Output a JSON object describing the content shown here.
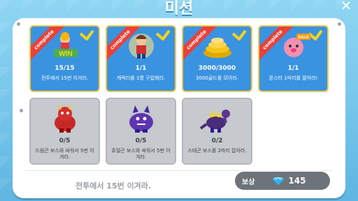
{
  "title": "미션",
  "close_icon": "close-icon",
  "missions": [
    {
      "status": "complete",
      "ribbon": "complete",
      "progress": "15/15",
      "description": "전투에서 15번 이겨라.",
      "icon": "win-trophy-icon"
    },
    {
      "status": "complete",
      "ribbon": "complete",
      "progress": "1/1",
      "description": "캐릭터를 1명 구입해라.",
      "icon": "character-icon"
    },
    {
      "status": "complete",
      "ribbon": "complete",
      "progress": "3000/3000",
      "description": "3000골드를 모아라.",
      "icon": "gold-coins-icon"
    },
    {
      "status": "complete",
      "ribbon": "complete",
      "progress": "1/1",
      "description": "몬스터 1마리를 팔아라!",
      "icon": "pig-monster-sale-icon",
      "badge": "SALE"
    },
    {
      "status": "incomplete",
      "progress": "0/5",
      "description": "드림곤 보스와 싸워서 5번 이겨라.",
      "icon": "red-dragon-boss-icon"
    },
    {
      "status": "incomplete",
      "progress": "0/5",
      "description": "쥬얼곤 보스와 싸워서 5번 이겨라.",
      "icon": "purple-dragon-boss-icon"
    },
    {
      "status": "incomplete",
      "progress": "0/2",
      "description": "스테곤 보스를 2마리 잡아라.",
      "icon": "stegosaurus-boss-icon"
    }
  ],
  "footer": {
    "current_mission": "전투에서 15번 이겨라.",
    "reward_label": "보상",
    "reward_icon": "diamond-icon",
    "reward_value": "145"
  },
  "colors": {
    "complete_card": "#3a93e0",
    "complete_border": "#f2c84b",
    "incomplete_card": "#c6c9cd",
    "ribbon": "#e8423b",
    "check": "#f5d21c"
  }
}
